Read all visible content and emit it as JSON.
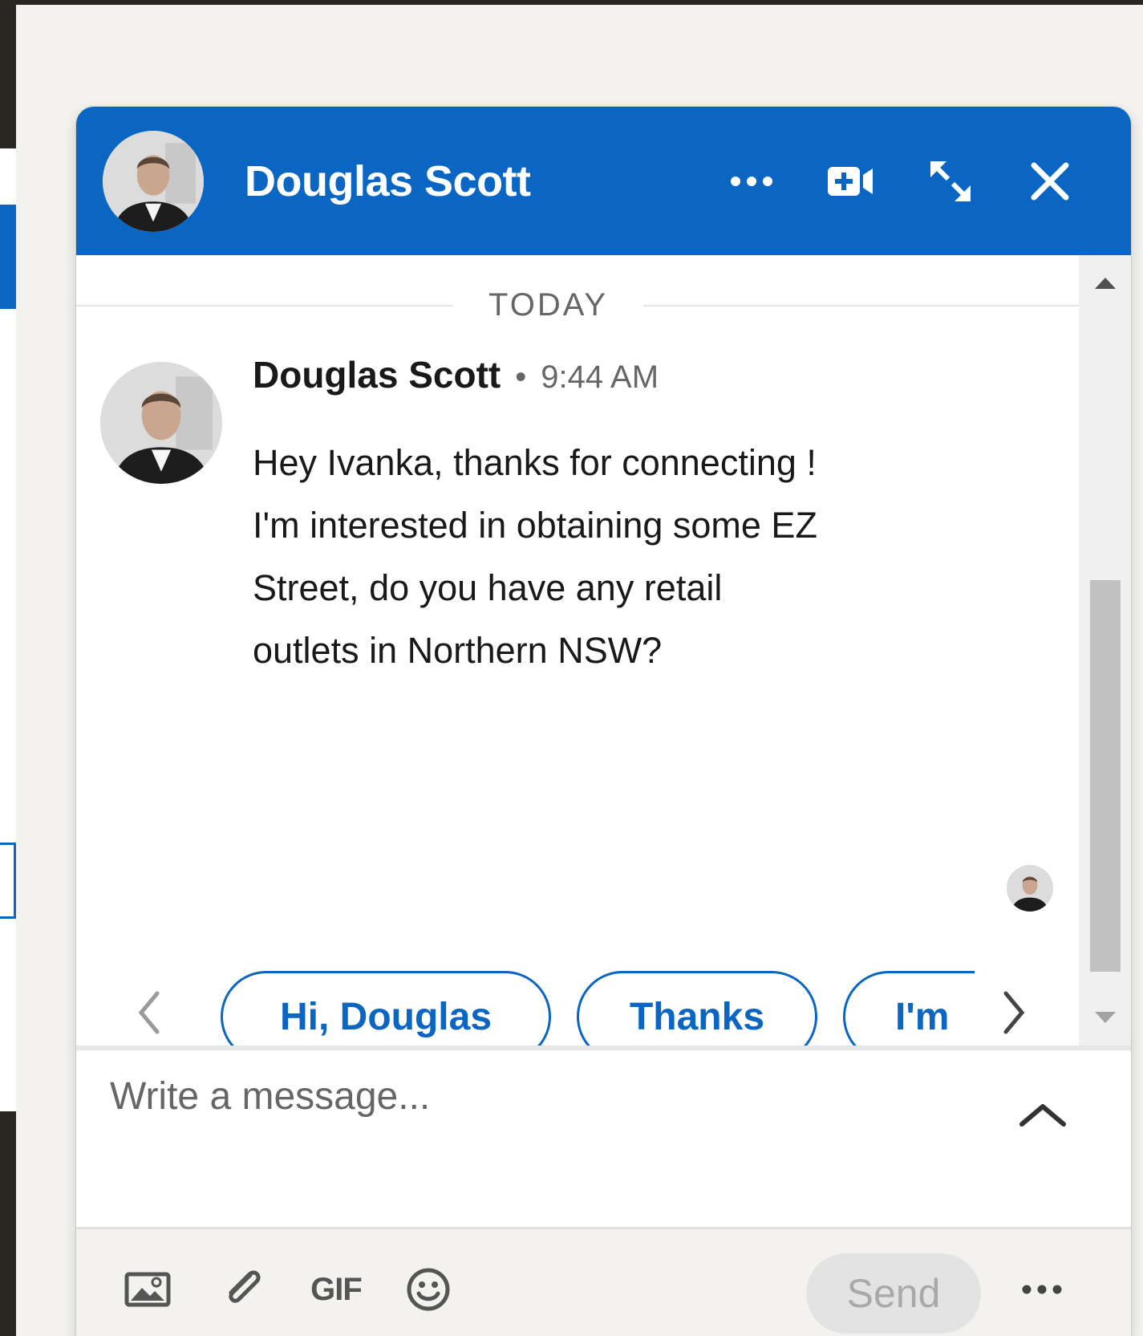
{
  "chat": {
    "title": "Douglas Scott",
    "accent_color": "#0a66c2",
    "header_actions": [
      {
        "name": "more-options",
        "icon": "ellipsis-icon"
      },
      {
        "name": "video-call",
        "icon": "video-plus-icon"
      },
      {
        "name": "expand-window",
        "icon": "expand-arrows-icon"
      },
      {
        "name": "close-window",
        "icon": "close-icon"
      }
    ]
  },
  "conversation": {
    "day_label": "TODAY",
    "messages": [
      {
        "sender": "Douglas Scott",
        "separator": "•",
        "time": "9:44 AM",
        "text": "Hey Ivanka, thanks for connecting ! I'm interested in obtaining some EZ Street, do you have any retail outlets in Northern NSW?"
      }
    ]
  },
  "suggestions": {
    "items": [
      "Hi, Douglas",
      "Thanks",
      "I'm"
    ],
    "prev_icon": "chevron-left-icon",
    "next_icon": "chevron-right-icon"
  },
  "composer": {
    "placeholder": "Write a message...",
    "expand_icon": "chevron-up-icon"
  },
  "toolbar": {
    "image_icon": "image-icon",
    "attach_icon": "paperclip-icon",
    "gif_label": "GIF",
    "emoji_icon": "emoji-icon",
    "send_label": "Send",
    "more_icon": "ellipsis-icon"
  }
}
